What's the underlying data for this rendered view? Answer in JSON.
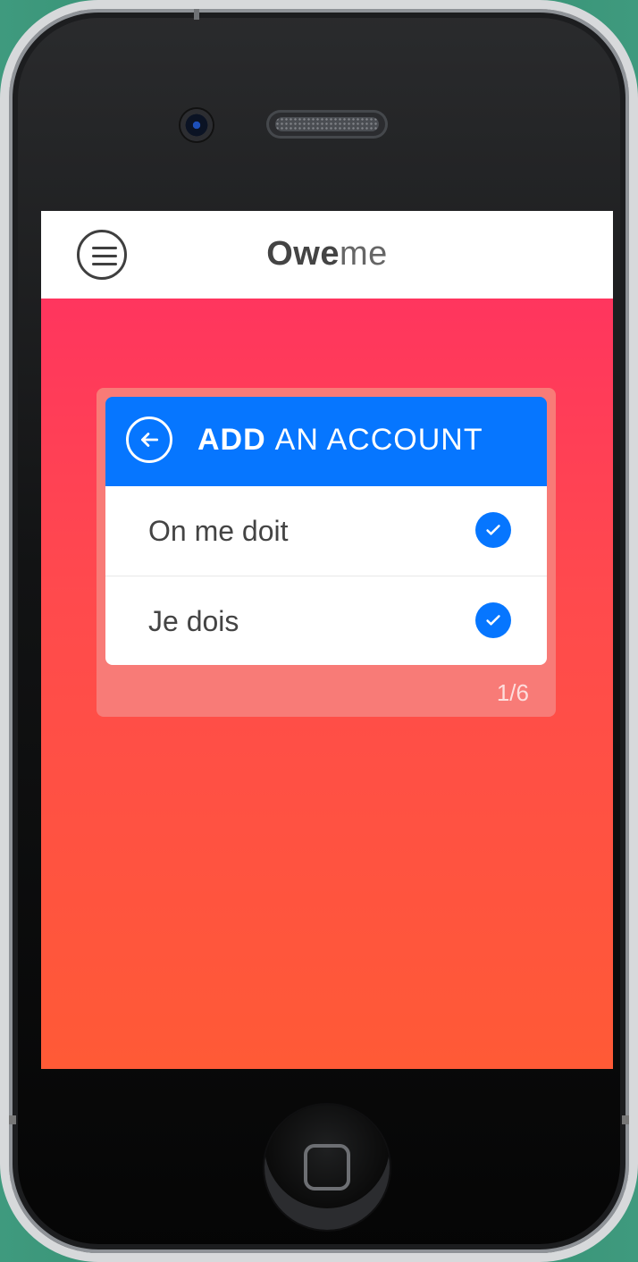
{
  "app": {
    "brand_bold": "Owe",
    "brand_light": "me"
  },
  "card": {
    "title_bold": "ADD",
    "title_light": "AN ACCOUNT",
    "options": [
      {
        "label": "On me doit"
      },
      {
        "label": "Je dois"
      }
    ],
    "pager": "1/6"
  },
  "icons": {
    "menu": "menu-icon",
    "back": "arrow-left-icon",
    "check": "check-icon",
    "home": "home-button-icon"
  },
  "colors": {
    "header_blue": "#0676ff",
    "screen_top": "#ff2f63",
    "screen_bottom": "#ff5a36",
    "panel": "#f87b77"
  }
}
